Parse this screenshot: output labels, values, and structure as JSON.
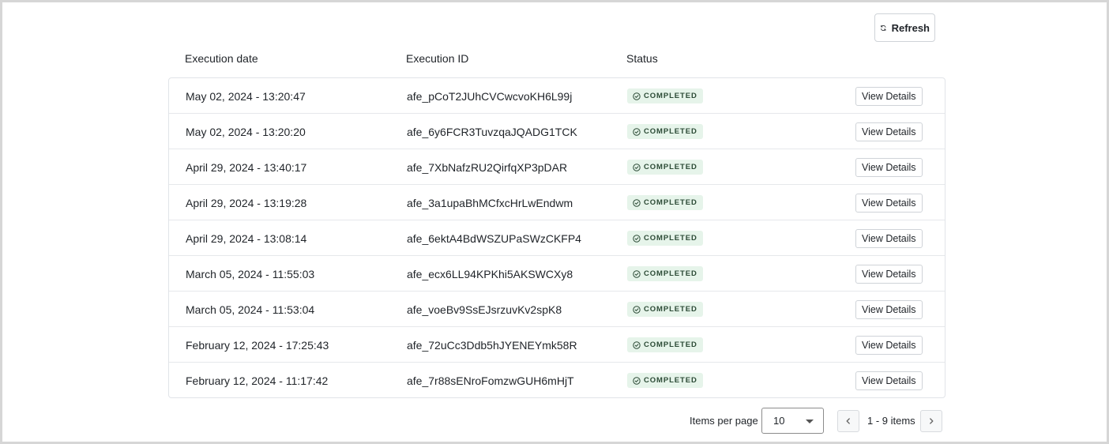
{
  "toolbar": {
    "refresh_label": "Refresh",
    "refresh_icon": "refresh-icon"
  },
  "table": {
    "columns": [
      "Execution date",
      "Execution ID",
      "Status"
    ],
    "rows": [
      {
        "date": "May 02, 2024 - 13:20:47",
        "id": "afe_pCoT2JUhCVCwcvoKH6L99j",
        "status": "COMPLETED",
        "action": "View Details"
      },
      {
        "date": "May 02, 2024 - 13:20:20",
        "id": "afe_6y6FCR3TuvzqaJQADG1TCK",
        "status": "COMPLETED",
        "action": "View Details"
      },
      {
        "date": "April 29, 2024 - 13:40:17",
        "id": "afe_7XbNafzRU2QirfqXP3pDAR",
        "status": "COMPLETED",
        "action": "View Details"
      },
      {
        "date": "April 29, 2024 - 13:19:28",
        "id": "afe_3a1upaBhMCfxcHrLwEndwm",
        "status": "COMPLETED",
        "action": "View Details"
      },
      {
        "date": "April 29, 2024 - 13:08:14",
        "id": "afe_6ektA4BdWSZUPaSWzCKFP4",
        "status": "COMPLETED",
        "action": "View Details"
      },
      {
        "date": "March 05, 2024 - 11:55:03",
        "id": "afe_ecx6LL94KPKhi5AKSWCXy8",
        "status": "COMPLETED",
        "action": "View Details"
      },
      {
        "date": "March 05, 2024 - 11:53:04",
        "id": "afe_voeBv9SsEJsrzuvKv2spK8",
        "status": "COMPLETED",
        "action": "View Details"
      },
      {
        "date": "February 12, 2024 - 17:25:43",
        "id": "afe_72uCc3Ddb5hJYENEYmk58R",
        "status": "COMPLETED",
        "action": "View Details"
      },
      {
        "date": "February 12, 2024 - 11:17:42",
        "id": "afe_7r88sENroFomzwGUH6mHjT",
        "status": "COMPLETED",
        "action": "View Details"
      }
    ]
  },
  "pagination": {
    "items_per_page_label": "Items per page",
    "items_per_page_value": "10",
    "range_label": "1 - 9 items"
  },
  "colors": {
    "badge_bg": "#e6f4ea",
    "badge_text": "#2b4a35",
    "border": "#e1e4e8"
  }
}
